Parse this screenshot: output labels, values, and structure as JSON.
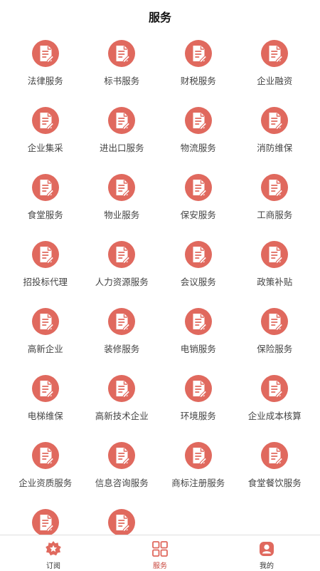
{
  "header": {
    "title": "服务"
  },
  "colors": {
    "accent": "#e0695e",
    "active_tab": "#c8453b"
  },
  "services": [
    {
      "label": "法律服务"
    },
    {
      "label": "标书服务"
    },
    {
      "label": "财税服务"
    },
    {
      "label": "企业融资"
    },
    {
      "label": "企业集采"
    },
    {
      "label": "进出口服务"
    },
    {
      "label": "物流服务"
    },
    {
      "label": "消防维保"
    },
    {
      "label": "食堂服务"
    },
    {
      "label": "物业服务"
    },
    {
      "label": "保安服务"
    },
    {
      "label": "工商服务"
    },
    {
      "label": "招投标代理"
    },
    {
      "label": "人力资源服务"
    },
    {
      "label": "会议服务"
    },
    {
      "label": "政策补贴"
    },
    {
      "label": "高新企业"
    },
    {
      "label": "装修服务"
    },
    {
      "label": "电销服务"
    },
    {
      "label": "保险服务"
    },
    {
      "label": "电梯维保"
    },
    {
      "label": "高新技术企业"
    },
    {
      "label": "环境服务"
    },
    {
      "label": "企业成本核算"
    },
    {
      "label": "企业资质服务"
    },
    {
      "label": "信息咨询服务"
    },
    {
      "label": "商标注册服务"
    },
    {
      "label": "食堂餐饮服务"
    },
    {
      "label": ""
    },
    {
      "label": ""
    }
  ],
  "service_icon": "document-edit-icon",
  "tabbar": {
    "items": [
      {
        "label": "订阅",
        "icon": "star-badge-icon",
        "active": false
      },
      {
        "label": "服务",
        "icon": "grid-icon",
        "active": true
      },
      {
        "label": "我的",
        "icon": "user-icon",
        "active": false
      }
    ]
  }
}
